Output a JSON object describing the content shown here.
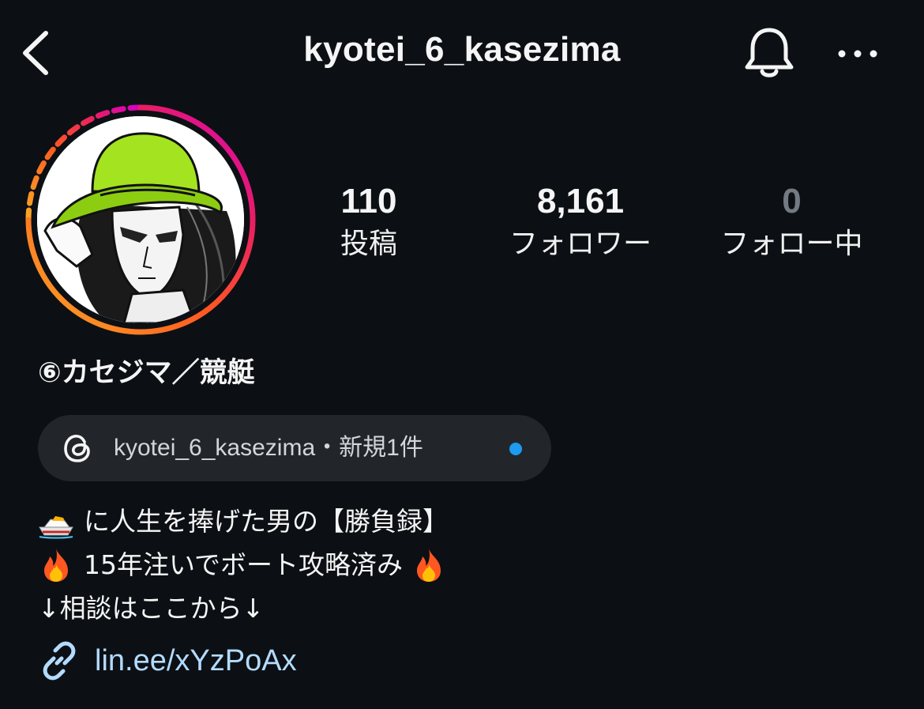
{
  "header": {
    "username": "kyotei_6_kasezima",
    "back_icon": "chevron-left-icon",
    "bell_icon": "bell-icon",
    "more_icon": "more-horizontal-icon"
  },
  "avatar": {
    "ring_colors": [
      "#f9a825",
      "#ff5722",
      "#e91e63",
      "#d500c4"
    ],
    "hat_color": "#a4e320"
  },
  "stats": {
    "posts": {
      "value": "110",
      "label": "投稿"
    },
    "followers": {
      "value": "8,161",
      "label": "フォロワー"
    },
    "following": {
      "value": "0",
      "label": "フォロー中"
    }
  },
  "profile": {
    "display_name": "⑥カセジマ／競艇"
  },
  "threads": {
    "icon": "threads-icon",
    "text": "kyotei_6_kasezima・新規1件",
    "dot_color": "#1d9bf0"
  },
  "bio": {
    "line1": "に人生を捧げた男の【勝負録】",
    "line2": "15年注いでボート攻略済み",
    "line3": "↓相談はここから↓",
    "emoji_boat": "speedboat-icon",
    "emoji_fire": "fire-icon"
  },
  "link": {
    "icon": "link-icon",
    "text": "lin.ee/xYzPoAx",
    "color": "#b3dbff"
  }
}
